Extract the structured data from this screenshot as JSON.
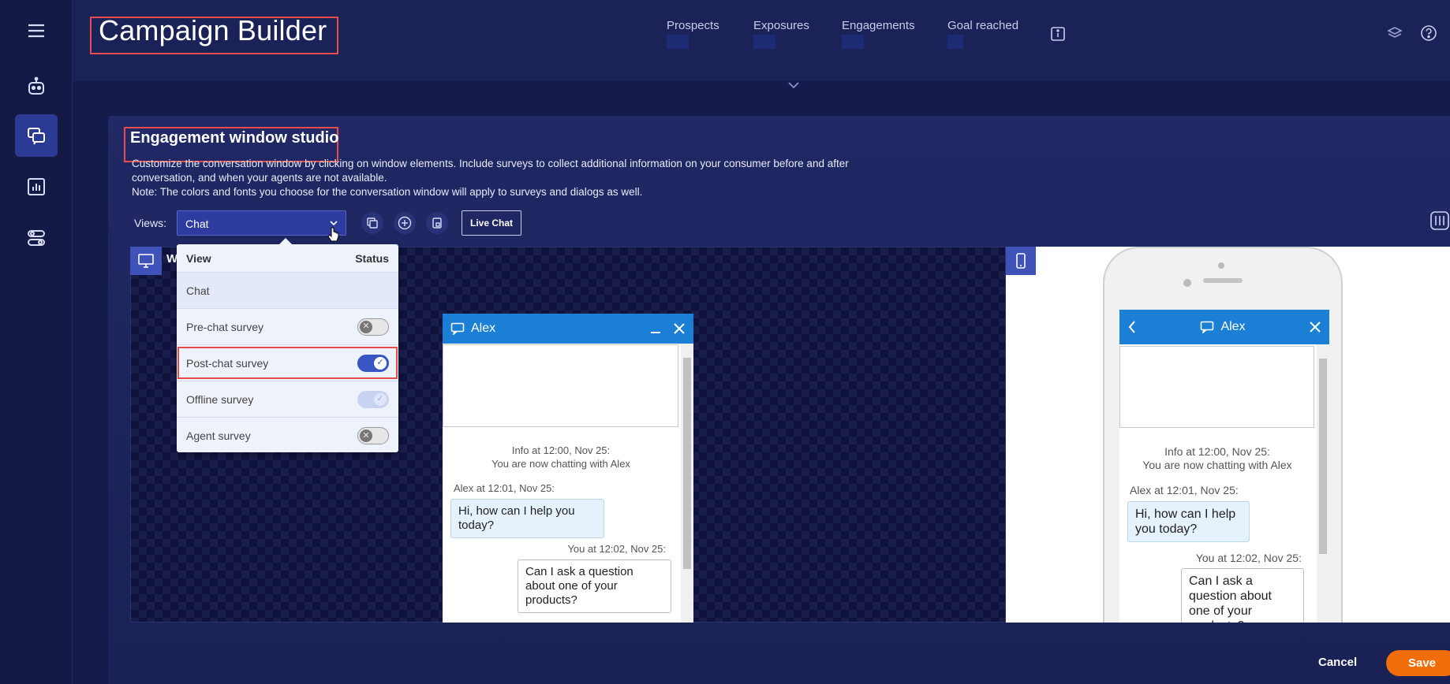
{
  "app": {
    "title": "Campaign Builder"
  },
  "header": {
    "metrics": [
      "Prospects",
      "Exposures",
      "Engagements",
      "Goal reached"
    ]
  },
  "section": {
    "title": "Engagement window studio",
    "description_line1": "Customize the conversation window by clicking on window elements. Include surveys to collect additional information on your consumer before and after",
    "description_line2": "conversation, and when your agents are not available.",
    "description_line3": "Note: The colors and fonts you choose for the conversation window will apply to surveys and dialogs as well."
  },
  "views": {
    "label": "Views:",
    "selected": "Chat",
    "live_chat": "Live Chat"
  },
  "preview": {
    "desktop_tag": "W"
  },
  "dropdown": {
    "col_view": "View",
    "col_status": "Status",
    "rows": [
      {
        "label": "Chat",
        "status": "none"
      },
      {
        "label": "Pre-chat survey",
        "status": "off"
      },
      {
        "label": "Post-chat survey",
        "status": "on"
      },
      {
        "label": "Offline survey",
        "status": "disabled-on"
      },
      {
        "label": "Agent survey",
        "status": "off"
      }
    ]
  },
  "chat": {
    "agent_name": "Alex",
    "info_line1": "Info at 12:00, Nov 25:",
    "info_line2": "You are now chatting with Alex",
    "agent_meta": "Alex at 12:01, Nov 25:",
    "agent_msg": "Hi, how can I help you today?",
    "user_meta": "You at 12:02, Nov 25:",
    "user_msg": "Can I ask a question about one of your products?"
  },
  "footer": {
    "cancel": "Cancel",
    "save": "Save"
  },
  "colors": {
    "accent": "#1c7fd6",
    "save": "#f06d0a",
    "highlight": "#e84b4b"
  }
}
